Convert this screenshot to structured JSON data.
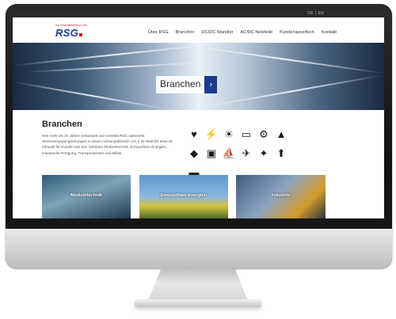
{
  "lang": {
    "de": "DE",
    "sep": "|",
    "en": "EN"
  },
  "brand": {
    "tagline": "ein Geschäftsbereich der",
    "logo": "RSG",
    "accent": "#d7202b",
    "primary": "#1b3a8c"
  },
  "nav": [
    "Über RSG",
    "Branchen",
    "DC/DC Wandler",
    "AC/DC Netzteile",
    "Kundenspezifisch",
    "Kontakt"
  ],
  "hero": {
    "label": "Branchen",
    "arrow": "›"
  },
  "section": {
    "title": "Branchen",
    "description": "Seit mehr als 20 Jahren entwickelt und vertreibt RSG optimierte Stromversorgungslösungen in einem Leistungsbereich von 0,25 Watt bis etwa 25 Kilowatt für Kunden aus den Sektoren Medizintechnik, Erneuerbare Energien, Industrielle Fertigung, Transportwesen und Militär."
  },
  "icons": [
    {
      "name": "medical-icon",
      "glyph": "♥"
    },
    {
      "name": "wind-turbine-icon",
      "glyph": "⚡"
    },
    {
      "name": "solar-icon",
      "glyph": "☀"
    },
    {
      "name": "monitor-icon",
      "glyph": "▭"
    },
    {
      "name": "robot-arm-icon",
      "glyph": "⚙"
    },
    {
      "name": "factory-icon",
      "glyph": "▲"
    },
    {
      "name": "car-icon",
      "glyph": "◆"
    },
    {
      "name": "train-icon",
      "glyph": "▣"
    },
    {
      "name": "ship-icon",
      "glyph": "⛵"
    },
    {
      "name": "airplane-icon",
      "glyph": "✈"
    },
    {
      "name": "satellite-icon",
      "glyph": "✦"
    },
    {
      "name": "rocket-icon",
      "glyph": "⬆"
    },
    {
      "name": "submarine-icon",
      "glyph": "▬"
    }
  ],
  "cards": [
    {
      "label": "Medizintechnik"
    },
    {
      "label": "Erneuerbare Energien"
    },
    {
      "label": "Industrie"
    }
  ]
}
